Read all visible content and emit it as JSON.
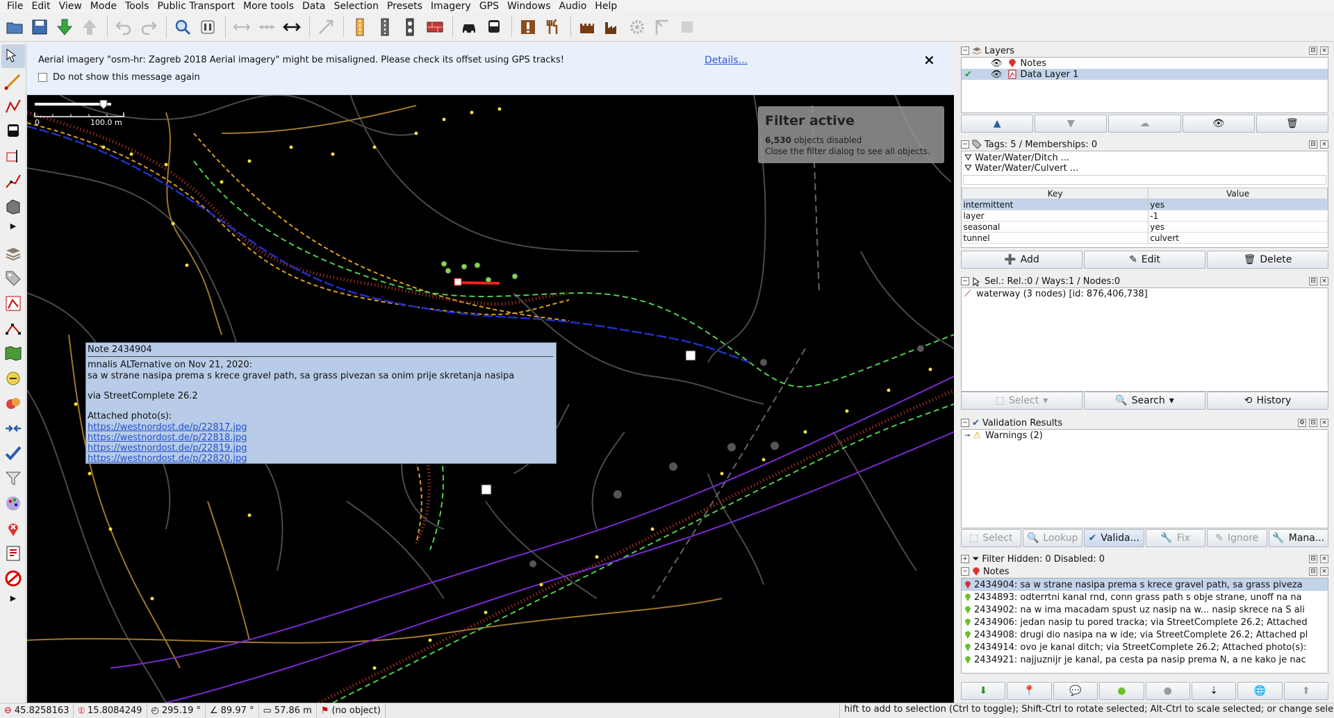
{
  "menubar": [
    "File",
    "Edit",
    "View",
    "Mode",
    "Tools",
    "Public Transport",
    "More tools",
    "Data",
    "Selection",
    "Presets",
    "Imagery",
    "GPS",
    "Windows",
    "Audio",
    "Help"
  ],
  "banner": {
    "message": "Aerial imagery \"osm-hr: Zagreb 2018 Aerial imagery\" might be misaligned. Please check its offset using GPS tracks!",
    "details_link": "Details...",
    "close": "×",
    "checkbox_label": "Do not show this message again"
  },
  "scale": {
    "start": "0",
    "end": "100.0 m"
  },
  "filter": {
    "title": "Filter active",
    "count": "6,530",
    "disabled_text": "objects disabled",
    "hint": "Close the filter dialog to see all objects."
  },
  "note_popup": {
    "title": "Note 2434904",
    "author_line": "mnalis ALTernative on Nov 21, 2020:",
    "text": "sa w strane nasipa prema s krece gravel path, sa grass pivezan sa onim prije skretanja nasipa",
    "via": "via StreetComplete 26.2",
    "attached": "Attached photo(s):",
    "links": [
      "https://westnordost.de/p/22817.jpg",
      "https://westnordost.de/p/22818.jpg",
      "https://westnordost.de/p/22819.jpg",
      "https://westnordost.de/p/22820.jpg"
    ]
  },
  "layers_panel": {
    "title": "Layers",
    "rows": [
      {
        "name": "Notes",
        "selected": false
      },
      {
        "name": "Data Layer 1",
        "selected": true
      }
    ]
  },
  "tags_panel": {
    "title": "Tags: 5 / Memberships: 0",
    "presets": [
      "Water/Water/Ditch ...",
      "Water/Water/Culvert ..."
    ],
    "headers": {
      "key": "Key",
      "value": "Value"
    },
    "rows": [
      {
        "key": "intermittent",
        "value": "yes",
        "selected": true
      },
      {
        "key": "layer",
        "value": "-1",
        "selected": false
      },
      {
        "key": "seasonal",
        "value": "yes",
        "selected": false
      },
      {
        "key": "tunnel",
        "value": "culvert",
        "selected": false
      }
    ],
    "buttons": {
      "add": "Add",
      "edit": "Edit",
      "delete": "Delete"
    }
  },
  "selection_panel": {
    "title": "Sel.: Rel.:0 / Ways:1 / Nodes:0",
    "item": "waterway (3 nodes) [id: 876,406,738]",
    "buttons": {
      "select": "Select",
      "search": "Search",
      "history": "History"
    }
  },
  "validation_panel": {
    "title": "Validation Results",
    "warnings": "Warnings (2)",
    "buttons": {
      "select": "Select",
      "lookup": "Lookup",
      "validate": "Valida...",
      "fix": "Fix",
      "ignore": "Ignore",
      "manage": "Mana..."
    }
  },
  "filter_panel": {
    "title": "Filter Hidden: 0 Disabled: 0"
  },
  "notes_panel": {
    "title": "Notes",
    "rows": [
      {
        "text": "2434904: sa w strane nasipa prema s krece gravel path, sa grass piveza",
        "selected": true,
        "color": "#d03030"
      },
      {
        "text": "2434893: odterrtni kanal rnd, conn grass path s obje strane, unoff na na",
        "selected": false,
        "color": "#6cbf2a"
      },
      {
        "text": "2434902: na w ima macadam spust uz nasip na w... nasip skrece na S ali",
        "selected": false,
        "color": "#6cbf2a"
      },
      {
        "text": "2434906: jedan nasip tu pored tracka; via StreetComplete 26.2; Attached",
        "selected": false,
        "color": "#6cbf2a"
      },
      {
        "text": "2434908: drugi dio nasipa na w ide; via StreetComplete 26.2; Attached pl",
        "selected": false,
        "color": "#6cbf2a"
      },
      {
        "text": "2434914: ovo je kanal ditch; via StreetComplete 26.2; Attached photo(s):",
        "selected": false,
        "color": "#6cbf2a"
      },
      {
        "text": "2434921: najjuznijr je kanal, pa cesta pa nasip prema N, a ne kako je nac",
        "selected": false,
        "color": "#6cbf2a"
      }
    ]
  },
  "statusbar": {
    "lat": "45.8258163",
    "lon": "15.8084249",
    "heading": "295.19 °",
    "angle": "89.97 °",
    "distance": "57.86 m",
    "object": "(no object)",
    "help": "hift to add to selection (Ctrl to toggle); Shift-Ctrl to rotate selected; Alt-Ctrl to scale selected; or change selection"
  }
}
